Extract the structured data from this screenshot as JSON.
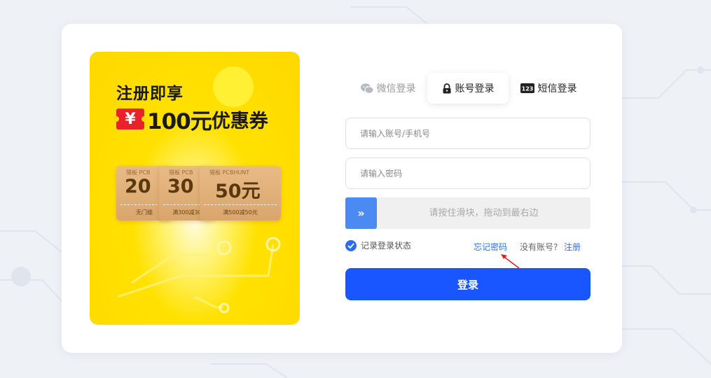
{
  "promo": {
    "title": "注册即享",
    "yen": "¥",
    "amount": "100元",
    "rest": "优惠券",
    "coupons": [
      {
        "brand": "猎板 PCB",
        "value": "20",
        "note": "无门槛"
      },
      {
        "brand": "猎板 PCB",
        "value": "30",
        "note": "满300减30"
      },
      {
        "brand": "猎板 PCBHUNT",
        "value": "50元",
        "note": "满500减50元"
      }
    ]
  },
  "tabs": [
    {
      "label": "微信登录",
      "icon": "wechat-icon"
    },
    {
      "label": "账号登录",
      "icon": "lock-icon"
    },
    {
      "label": "短信登录",
      "icon": "sms-123-icon"
    }
  ],
  "form": {
    "account_placeholder": "请输入账号/手机号",
    "password_placeholder": "请输入密码",
    "slider_text": "请按住滑块，拖动到最右边",
    "slider_handle": "»",
    "remember_label": "记录登录状态",
    "forgot_label": "忘记密码",
    "no_account_label": "没有账号?",
    "register_label": "注册",
    "login_label": "登录"
  },
  "colors": {
    "primary": "#1a56ff",
    "link": "#2a6ef0",
    "slider_handle": "#4a8af2",
    "promo_yellow": "#ffd800",
    "tag_red": "#e8212b"
  }
}
